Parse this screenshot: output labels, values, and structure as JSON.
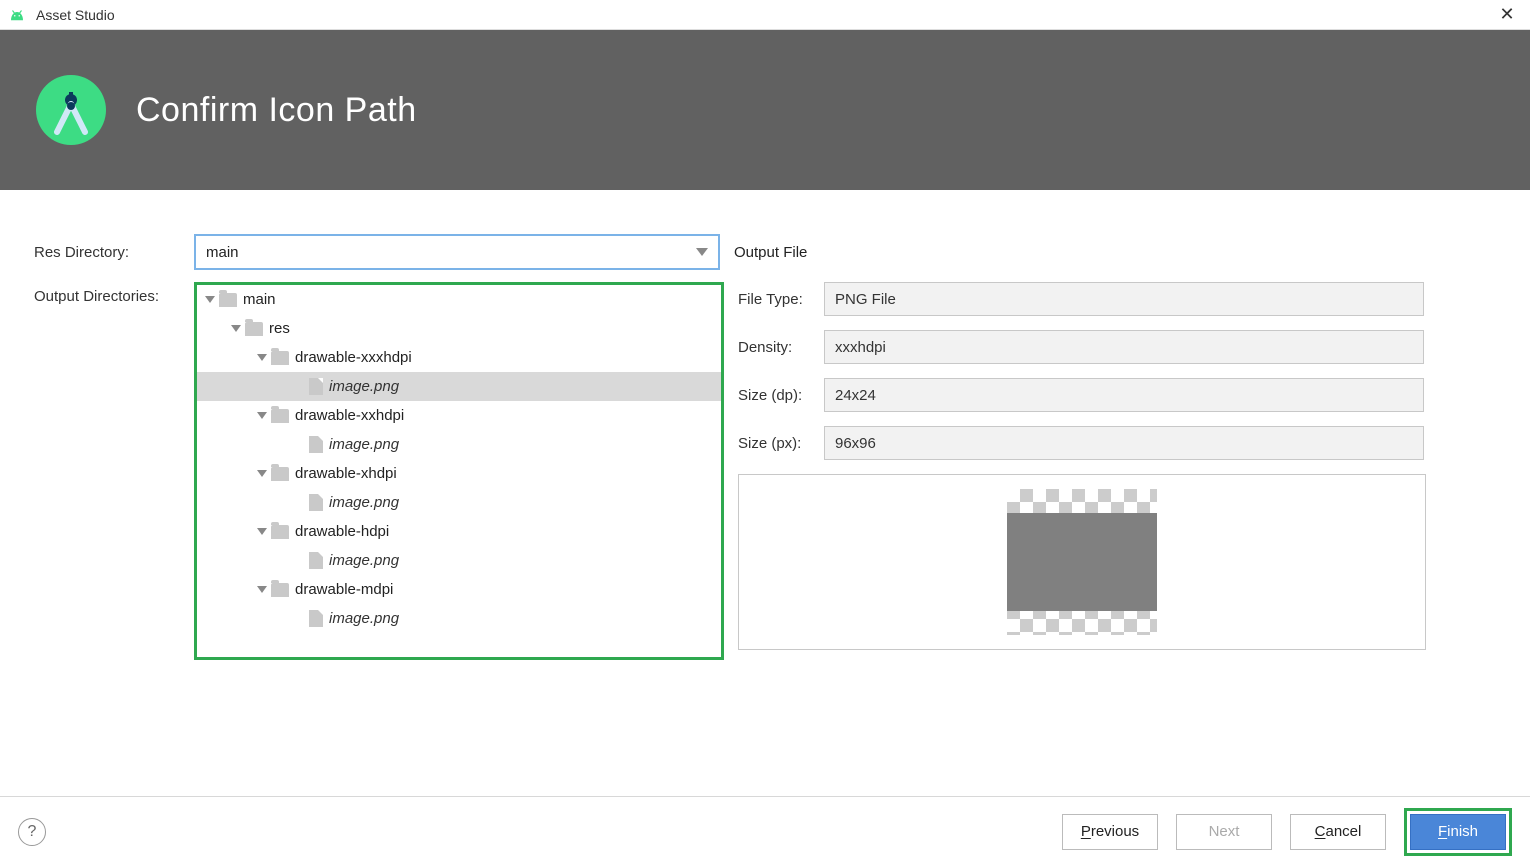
{
  "window_title": "Asset Studio",
  "banner_title": "Confirm Icon Path",
  "labels": {
    "res_directory": "Res Directory:",
    "output_directories": "Output Directories:",
    "output_file": "Output File",
    "file_type": "File Type:",
    "density": "Density:",
    "size_dp": "Size (dp):",
    "size_px": "Size (px):"
  },
  "res_directory_value": "main",
  "tree": {
    "root": "main",
    "child": "res",
    "folders": [
      {
        "name": "drawable-xxxhdpi",
        "file": "image.png",
        "selected": true
      },
      {
        "name": "drawable-xxhdpi",
        "file": "image.png",
        "selected": false
      },
      {
        "name": "drawable-xhdpi",
        "file": "image.png",
        "selected": false
      },
      {
        "name": "drawable-hdpi",
        "file": "image.png",
        "selected": false
      },
      {
        "name": "drawable-mdpi",
        "file": "image.png",
        "selected": false
      }
    ]
  },
  "output_file": {
    "file_type": "PNG File",
    "density": "xxxhdpi",
    "size_dp": "24x24",
    "size_px": "96x96"
  },
  "buttons": {
    "previous": "Previous",
    "previous_mnemonic": "P",
    "next": "Next",
    "cancel": "Cancel",
    "cancel_mnemonic": "C",
    "finish": "Finish",
    "finish_mnemonic": "F"
  }
}
